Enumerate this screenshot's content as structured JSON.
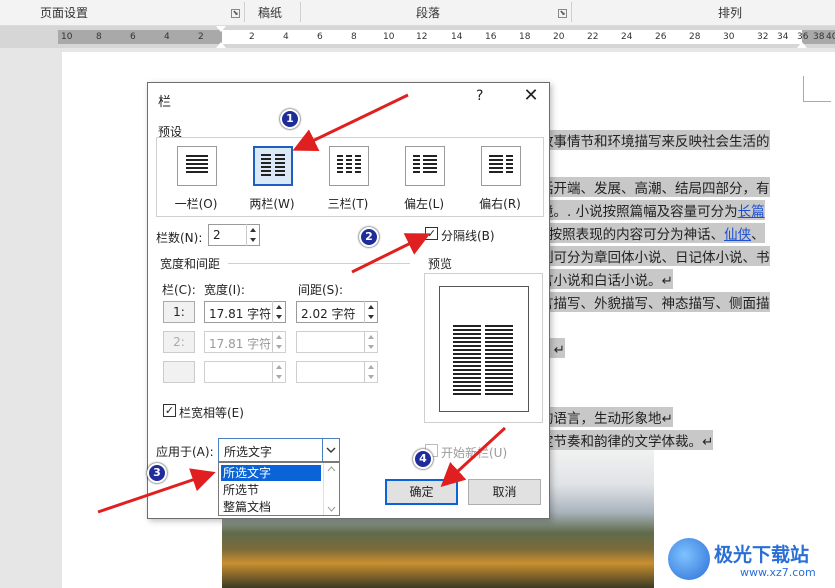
{
  "ribbon": {
    "groups": [
      "页面设置",
      "稿纸",
      "段落",
      "排列"
    ],
    "launcher_glyph": "⬊"
  },
  "ruler": {
    "ticks": [
      "10",
      "8",
      "6",
      "4",
      "2",
      "2",
      "4",
      "6",
      "8",
      "10",
      "12",
      "14",
      "16",
      "18",
      "20",
      "22",
      "24",
      "26",
      "28",
      "30",
      "32",
      "34",
      "36",
      "38",
      "40"
    ]
  },
  "document": {
    "lines": [
      {
        "text": "故事情节和环境描写来反映社会生活的"
      },
      {
        "text": "括开端、发展、高潮、结局四部分，有"
      },
      {
        "pre": "境。. 小说按照篇幅及容量可分为",
        "link": "长篇"
      },
      {
        "pre": ", 按照表现的内容可分为神话、",
        "link": "仙侠",
        "post": "、"
      },
      {
        "text": "制可分为章回体小说、日记体小说、书"
      },
      {
        "text": "言小说和白话小说。↵"
      },
      {
        "text": "言描写、外貌描写、神态描写、侧面描"
      },
      {
        "text": "。↵"
      },
      {
        "text": "的语言，生动形象地↵"
      },
      {
        "text": "定节奏和韵律的文学体裁。↵"
      }
    ]
  },
  "dialog": {
    "title": "栏",
    "help": "?",
    "close": "✕",
    "preset_label": "预设",
    "presets": [
      {
        "label": "一栏(O)"
      },
      {
        "label": "两栏(W)"
      },
      {
        "label": "三栏(T)"
      },
      {
        "label": "偏左(L)"
      },
      {
        "label": "偏右(R)"
      }
    ],
    "columns_label": "栏数(N):",
    "columns_value": "2",
    "separator_label": "分隔线(B)",
    "separator_checked": "✓",
    "width_spacing_label": "宽度和间距",
    "col_header": "栏(C):",
    "width_header": "宽度(I):",
    "spacing_header": "间距(S):",
    "rows": [
      {
        "num": "1:",
        "width": "17.81 字符",
        "spacing": "2.02 字符"
      },
      {
        "num": "2:",
        "width": "17.81 字符",
        "spacing": ""
      },
      {
        "num": "",
        "width": "",
        "spacing": ""
      }
    ],
    "equal_width_label": "栏宽相等(E)",
    "equal_width_checked": "✓",
    "preview_label": "预览",
    "apply_label": "应用于(A):",
    "apply_value": "所选文字",
    "apply_options": [
      "所选文字",
      "所选节",
      "整篇文档"
    ],
    "new_column_label": "开始新栏(U)",
    "ok": "确定",
    "cancel": "取消"
  },
  "callouts": [
    "1",
    "2",
    "3",
    "4"
  ],
  "watermark": {
    "title": "极光下载站",
    "url": "www.xz7.com"
  },
  "colors": {
    "accent": "#0a64d7",
    "badge": "#1f2d9a",
    "arrow": "#e02020"
  }
}
